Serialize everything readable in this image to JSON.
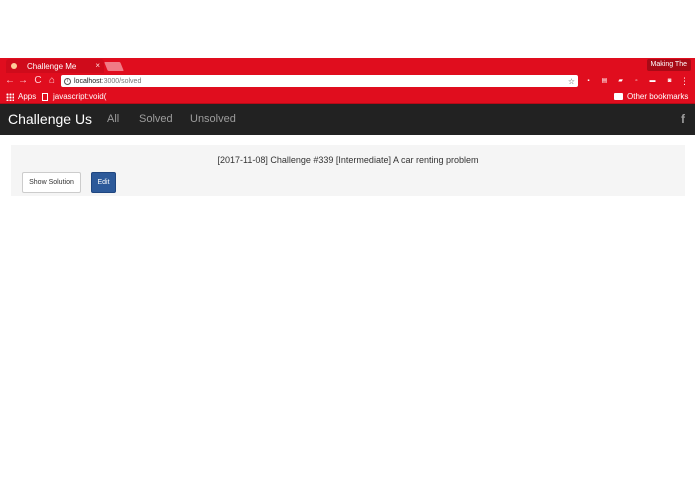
{
  "browser": {
    "tab": {
      "title": "Challenge Me",
      "close_glyph": "×"
    },
    "profile_name": "Making The",
    "nav": {
      "back": "←",
      "forward": "→",
      "reload": "C",
      "home": "⌂"
    },
    "url": {
      "host": "localhost",
      "path": ":3000/solved"
    },
    "bookmarks": [
      {
        "label": "Apps",
        "icon": "apps-icon"
      },
      {
        "label": "javascript:void(",
        "icon": "page-icon"
      }
    ],
    "other_bookmarks": "Other bookmarks"
  },
  "app": {
    "brand": "Challenge Us",
    "nav": [
      {
        "label": "All"
      },
      {
        "label": "Solved"
      },
      {
        "label": "Unsolved"
      }
    ],
    "social_icon": "facebook-icon",
    "social_glyph": "f"
  },
  "challenge": {
    "title": "[2017-11-08] Challenge #339 [Intermediate] A car renting problem",
    "show_solution_label": "Show Solution",
    "edit_label": "Edit"
  },
  "colors": {
    "chrome_red": "#e00d1e",
    "navbar_bg": "#222222",
    "primary_button": "#2d5a9a",
    "panel_bg": "#f5f5f5"
  }
}
